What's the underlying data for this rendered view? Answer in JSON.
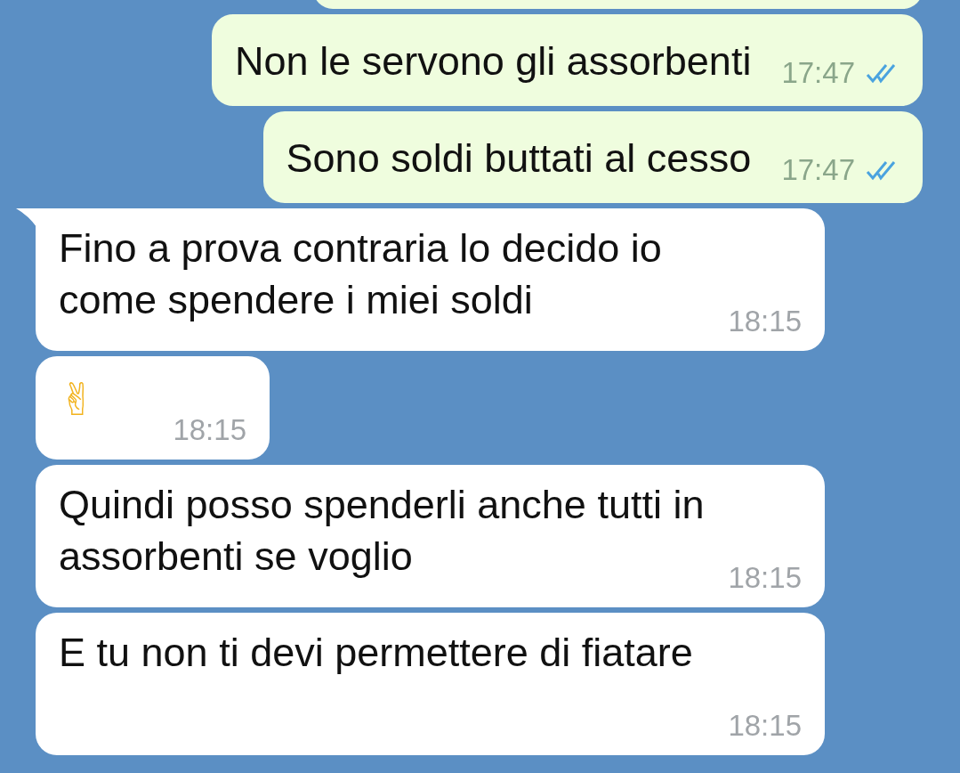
{
  "messages": [
    {
      "kind": "outgoing",
      "text": "Non le servono gli assorbenti",
      "time": "17:47",
      "read": true
    },
    {
      "kind": "outgoing",
      "text": "Sono soldi buttati al cesso",
      "time": "17:47",
      "read": true
    },
    {
      "kind": "incoming",
      "text": "Fino a prova contraria lo decido io come spendere i miei soldi",
      "time": "18:15",
      "tail": true
    },
    {
      "kind": "incoming_emoji",
      "text": "✌",
      "time": "18:15",
      "tail": false
    },
    {
      "kind": "incoming",
      "text": "Quindi posso spenderli anche tutti in assorbenti se voglio",
      "time": "18:15",
      "tail": false
    },
    {
      "kind": "incoming",
      "text": "E tu non ti devi permettere di fiatare",
      "time": "18:15",
      "tail": false
    }
  ]
}
